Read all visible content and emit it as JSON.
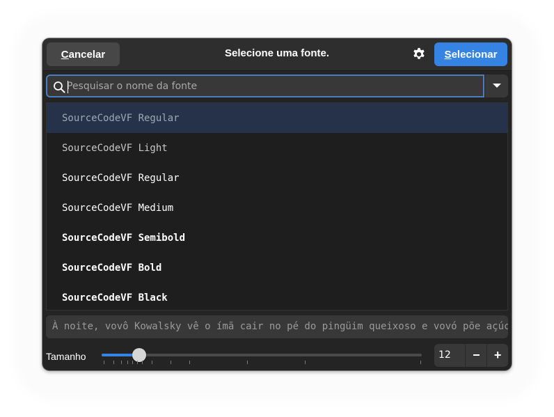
{
  "header": {
    "cancel_prefix": "C",
    "cancel_rest": "ancelar",
    "title": "Selecione uma fonte.",
    "select_prefix": "S",
    "select_rest": "elecionar"
  },
  "search": {
    "placeholder": "Pesquisar o nome da fonte",
    "value": ""
  },
  "font_list": {
    "items": [
      {
        "label": "SourceCodeVF Regular",
        "weight": 400,
        "selected": true
      },
      {
        "label": "SourceCodeVF Light",
        "weight": 300,
        "selected": false
      },
      {
        "label": "SourceCodeVF Regular",
        "weight": 400,
        "selected": false
      },
      {
        "label": "SourceCodeVF Medium",
        "weight": 500,
        "selected": false
      },
      {
        "label": "SourceCodeVF Semibold",
        "weight": 600,
        "selected": false
      },
      {
        "label": "SourceCodeVF Bold",
        "weight": 700,
        "selected": false
      },
      {
        "label": "SourceCodeVF Black",
        "weight": 900,
        "selected": false
      }
    ]
  },
  "preview": {
    "text": "À noite, vovô Kowalsky vê o ímã cair no pé do pingüim queixoso e vovó põe açúcar no chá de tâmaras do jabuti feliz."
  },
  "size": {
    "label": "Tamanho",
    "value": "12",
    "minus": "−",
    "plus": "+",
    "slider_fraction": 0.09
  },
  "colors": {
    "accent": "#3584e4",
    "window_bg": "#242424",
    "selected_row": "#25324a"
  },
  "icons": {
    "gear": "gear-icon",
    "search": "search-icon",
    "dropdown": "chevron-down-icon"
  }
}
